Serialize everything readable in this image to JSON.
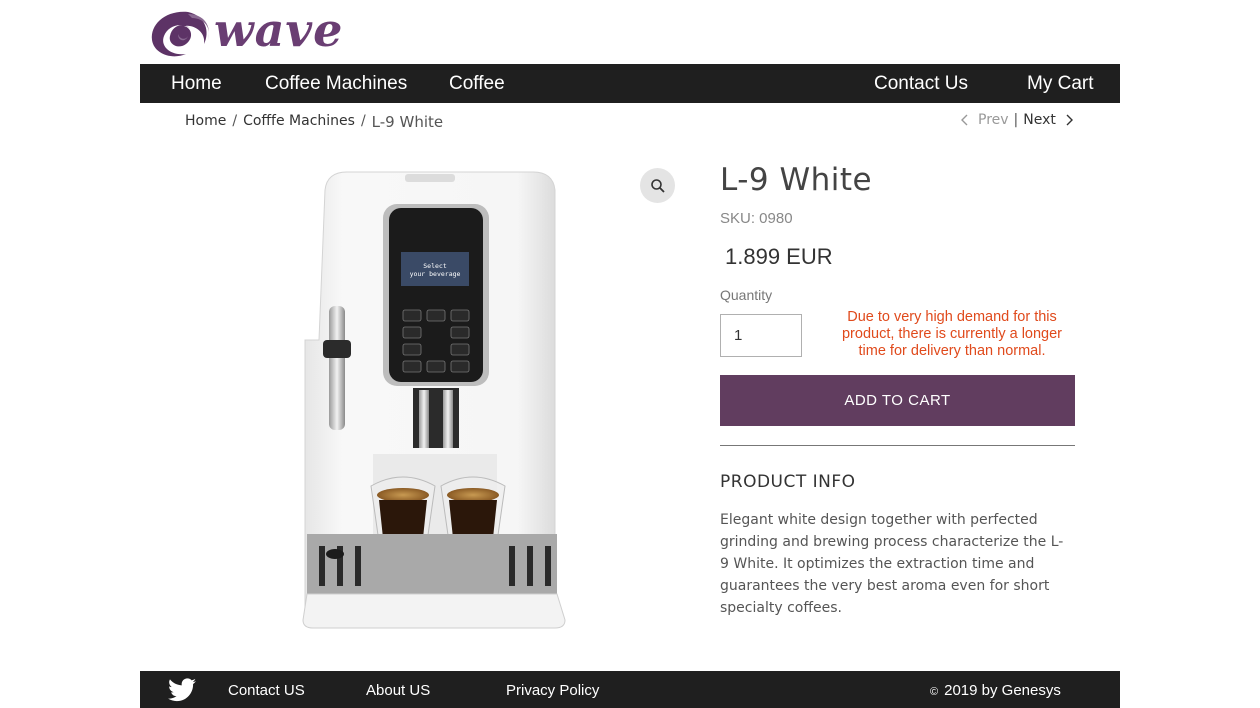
{
  "brand": {
    "logo_text": "wave",
    "colors": {
      "brand": "#6a3e73",
      "accent_button": "#613d5f",
      "nav_bg": "#1f1f1f",
      "notice": "#e04a1c"
    }
  },
  "nav": {
    "home": "Home",
    "coffee_machines": "Coffee Machines",
    "coffee": "Coffee",
    "contact": "Contact Us",
    "cart": "My Cart"
  },
  "breadcrumb": {
    "items": [
      "Home",
      "Cofffe Machines",
      "L-9 White"
    ],
    "separator": "/"
  },
  "pager": {
    "prev": "Prev",
    "divider": "|",
    "next": "Next"
  },
  "product": {
    "title": "L-9 White",
    "sku": "SKU: 0980",
    "price": "1.899 EUR",
    "quantity_label": "Quantity",
    "quantity_value": "1",
    "availability_notice": "Due to very high demand for this product, there is currently a longer time for delivery than normal.",
    "add_to_cart": "ADD TO CART",
    "info_heading": "PRODUCT INFO",
    "info_text": "Elegant white design together with perfected grinding and brewing process characterize the L-9 White. It optimizes the extraction time and guarantees the very best aroma even for short specialty coffees.",
    "image_icon": "coffee-machine-image",
    "screen_text_line1": "Select",
    "screen_text_line2": "your beverage"
  },
  "footer": {
    "twitter_icon": "twitter-icon",
    "contact": "Contact US",
    "about": "About US",
    "privacy": "Privacy Policy",
    "copyright_symbol": "©",
    "copyright": "2019 by Genesys"
  }
}
